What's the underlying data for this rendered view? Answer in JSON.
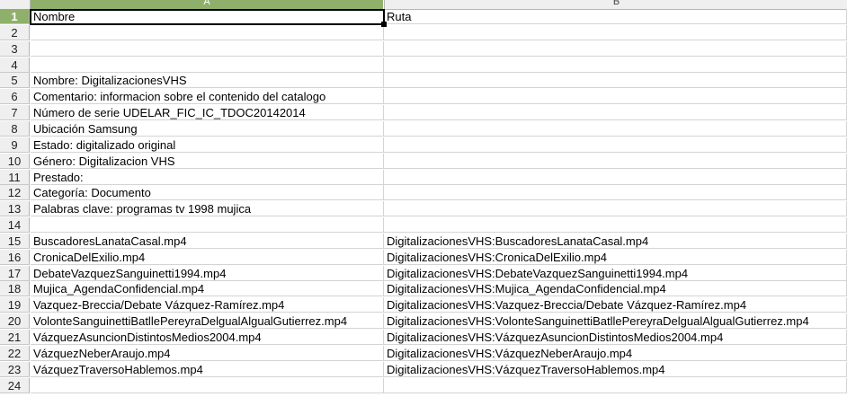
{
  "columns": [
    {
      "letter": "A",
      "selected": true
    },
    {
      "letter": "B",
      "selected": false
    }
  ],
  "rows": [
    {
      "num": "1",
      "a": "Nombre",
      "b": "Ruta"
    },
    {
      "num": "2",
      "a": "",
      "b": ""
    },
    {
      "num": "3",
      "a": "",
      "b": ""
    },
    {
      "num": "4",
      "a": "",
      "b": ""
    },
    {
      "num": "5",
      "a": "Nombre: DigitalizacionesVHS",
      "b": ""
    },
    {
      "num": "6",
      "a": "Comentario: informacion sobre el contenido del catalogo",
      "b": ""
    },
    {
      "num": "7",
      "a": "Número de serie UDELAR_FIC_IC_TDOC20142014",
      "b": ""
    },
    {
      "num": "8",
      "a": "Ubicación Samsung",
      "b": ""
    },
    {
      "num": "9",
      "a": "Estado: digitalizado original",
      "b": ""
    },
    {
      "num": "10",
      "a": "Género: Digitalizacion VHS",
      "b": ""
    },
    {
      "num": "11",
      "a": "Prestado:",
      "b": ""
    },
    {
      "num": "12",
      "a": "Categoría: Documento",
      "b": ""
    },
    {
      "num": "13",
      "a": "Palabras clave: programas tv 1998 mujica",
      "b": ""
    },
    {
      "num": "14",
      "a": "",
      "b": ""
    },
    {
      "num": "15",
      "a": "BuscadoresLanataCasal.mp4",
      "b": "DigitalizacionesVHS:BuscadoresLanataCasal.mp4"
    },
    {
      "num": "16",
      "a": "CronicaDelExilio.mp4",
      "b": "DigitalizacionesVHS:CronicaDelExilio.mp4"
    },
    {
      "num": "17",
      "a": "DebateVazquezSanguinetti1994.mp4",
      "b": "DigitalizacionesVHS:DebateVazquezSanguinetti1994.mp4"
    },
    {
      "num": "18",
      "a": "Mujica_AgendaConfidencial.mp4",
      "b": "DigitalizacionesVHS:Mujica_AgendaConfidencial.mp4"
    },
    {
      "num": "19",
      "a": "Vazquez-Breccia/Debate Vázquez-Ramírez.mp4",
      "b": "DigitalizacionesVHS:Vazquez-Breccia/Debate Vázquez-Ramírez.mp4"
    },
    {
      "num": "20",
      "a": "VolonteSanguinettiBatllePereyraDelgualAlgualGutierrez.mp4",
      "b": "DigitalizacionesVHS:VolonteSanguinettiBatllePereyraDelgualAlgualGutierrez.mp4"
    },
    {
      "num": "21",
      "a": "VázquezAsuncionDistintosMedios2004.mp4",
      "b": "DigitalizacionesVHS:VázquezAsuncionDistintosMedios2004.mp4"
    },
    {
      "num": "22",
      "a": "VázquezNeberAraujo.mp4",
      "b": "DigitalizacionesVHS:VázquezNeberAraujo.mp4"
    },
    {
      "num": "23",
      "a": "VázquezTraversoHablemos.mp4",
      "b": "DigitalizacionesVHS:VázquezTraversoHablemos.mp4"
    },
    {
      "num": "24",
      "a": "",
      "b": ""
    }
  ],
  "selection": {
    "active_row": "1",
    "active_column": "A"
  },
  "colors": {
    "selected_header": "#8fb06a",
    "header_bg": "#efefef",
    "grid": "#d4d4d4"
  }
}
